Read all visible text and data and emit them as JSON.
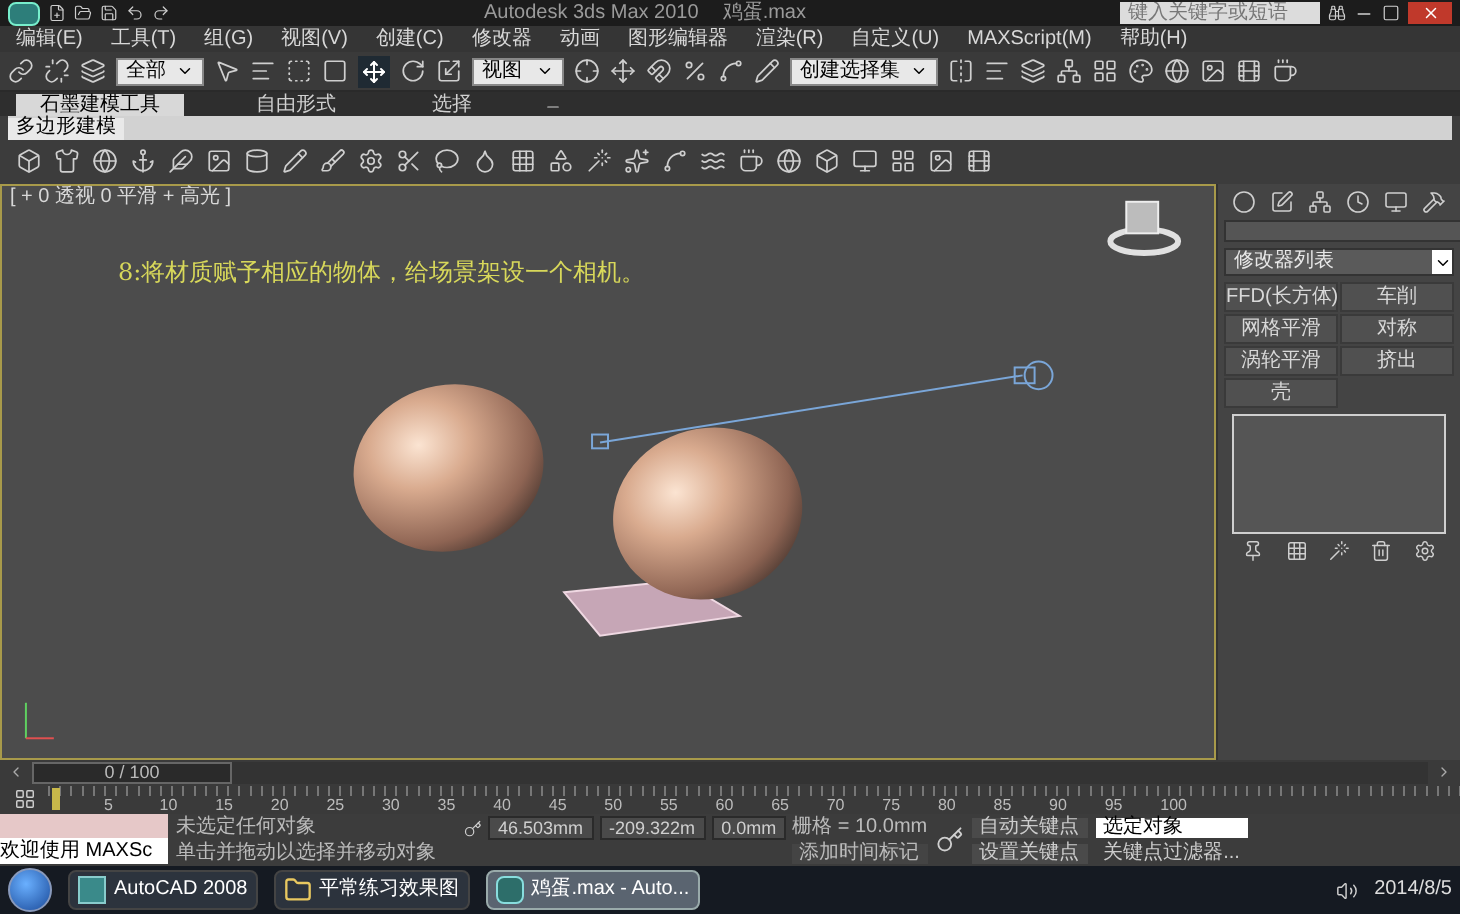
{
  "title_bar": {
    "app_title": "Autodesk 3ds Max 2010",
    "file_name": "鸡蛋.max",
    "search": {
      "placeholder": "键入关键字或短语"
    }
  },
  "menu": [
    "编辑(E)",
    "工具(T)",
    "组(G)",
    "视图(V)",
    "创建(C)",
    "修改器",
    "动画",
    "图形编辑器",
    "渲染(R)",
    "自定义(U)",
    "MAXScript(M)",
    "帮助(H)"
  ],
  "main_toolbar": {
    "selection_filter": "全部",
    "reference_coord": "视图",
    "named_selection": "创建选择集"
  },
  "ribbon": {
    "tabs": [
      {
        "label": "石墨建模工具",
        "selected": true
      },
      {
        "label": "自由形式",
        "selected": false
      },
      {
        "label": "选择",
        "selected": false
      }
    ],
    "panel_label": "多边形建模"
  },
  "viewport": {
    "label": "[ + 0 透视 0 平滑 + 高光 ]",
    "caption": "8:将材质赋予相应的物体，给场景架设一个相机。"
  },
  "command_panel": {
    "modifier_list": "修改器列表",
    "modifier_buttons": [
      "FFD(长方体)",
      "车削",
      "网格平滑",
      "对称",
      "涡轮平滑",
      "挤出",
      "壳"
    ]
  },
  "timeline": {
    "frame": "0 / 100",
    "level": 0,
    "ticks": [
      "5",
      "10",
      "15",
      "20",
      "25",
      "30",
      "35",
      "40",
      "45",
      "50",
      "55",
      "60",
      "65",
      "70",
      "75",
      "80",
      "85",
      "90",
      "95",
      "100"
    ]
  },
  "status": {
    "welcome": "欢迎使用 MAXSc",
    "selection": "未选定任何对象",
    "hint": "单击并拖动以选择并移动对象",
    "x": "46.503mm",
    "y": "-209.322m",
    "z": "0.0mm",
    "grid": "栅格 = 10.0mm",
    "add_time_tag": "添加时间标记",
    "auto_key": "自动关键点",
    "key_mode": "选定对象",
    "set_key": "设置关键点",
    "key_filters": "关键点过滤器..."
  },
  "taskbar": {
    "items": [
      {
        "label": "AutoCAD 2008",
        "kind": "app",
        "selected": false
      },
      {
        "label": "平常练习效果图",
        "kind": "folder",
        "selected": false
      },
      {
        "label": "鸡蛋.max - Auto...",
        "kind": "max",
        "selected": true
      }
    ],
    "date": "2014/8/5"
  }
}
